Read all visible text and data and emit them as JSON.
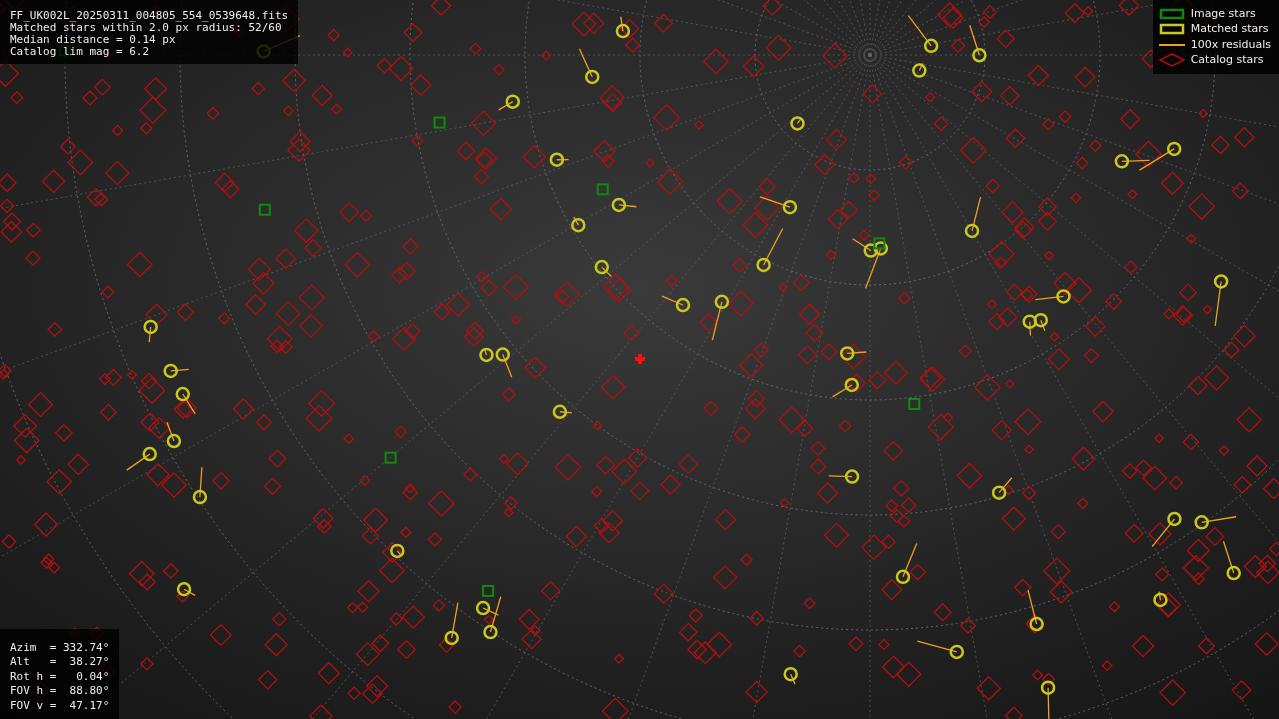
{
  "info_panel": {
    "lines": [
      "FF_UK002L_20250311_004805_554_0539648.fits",
      "Matched stars within 2.0 px radius: 52/60",
      "Median distance = 0.14 px",
      "Catalog lim mag = 6.2"
    ]
  },
  "legend": [
    {
      "kind": "box",
      "label": "Image stars",
      "color": "#0f8a0f"
    },
    {
      "kind": "box",
      "label": "Matched stars",
      "color": "#c8c81e"
    },
    {
      "kind": "line",
      "label": "100x residuals",
      "color": "#f0a020"
    },
    {
      "kind": "diamond",
      "label": "Catalog stars",
      "color": "#b01010"
    }
  ],
  "pointing_panel": {
    "lines": [
      "Azim  = 332.74°",
      "Alt   =  38.27°",
      "Rot h =   0.04°",
      "FOV h =  88.80°",
      "FOV v =  47.17°"
    ]
  }
}
